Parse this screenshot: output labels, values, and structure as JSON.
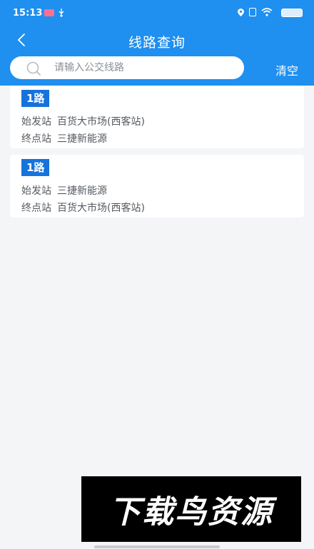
{
  "status_bar": {
    "time": "15:13"
  },
  "nav": {
    "title": "线路查询"
  },
  "search": {
    "placeholder": "请输入公交线路",
    "value": "",
    "clear_label": "清空"
  },
  "routes": [
    {
      "name": "1路",
      "start_label": "始发站",
      "start": "百货大市场(西客站)",
      "end_label": "终点站",
      "end": "三捷新能源"
    },
    {
      "name": "1路",
      "start_label": "始发站",
      "start": "三捷新能源",
      "end_label": "终点站",
      "end": "百货大市场(西客站)"
    }
  ],
  "watermark": {
    "text": "下载鸟资源"
  },
  "colors": {
    "header": "#1f8ff0",
    "badge": "#1673dc",
    "background": "#f4f5f7"
  }
}
